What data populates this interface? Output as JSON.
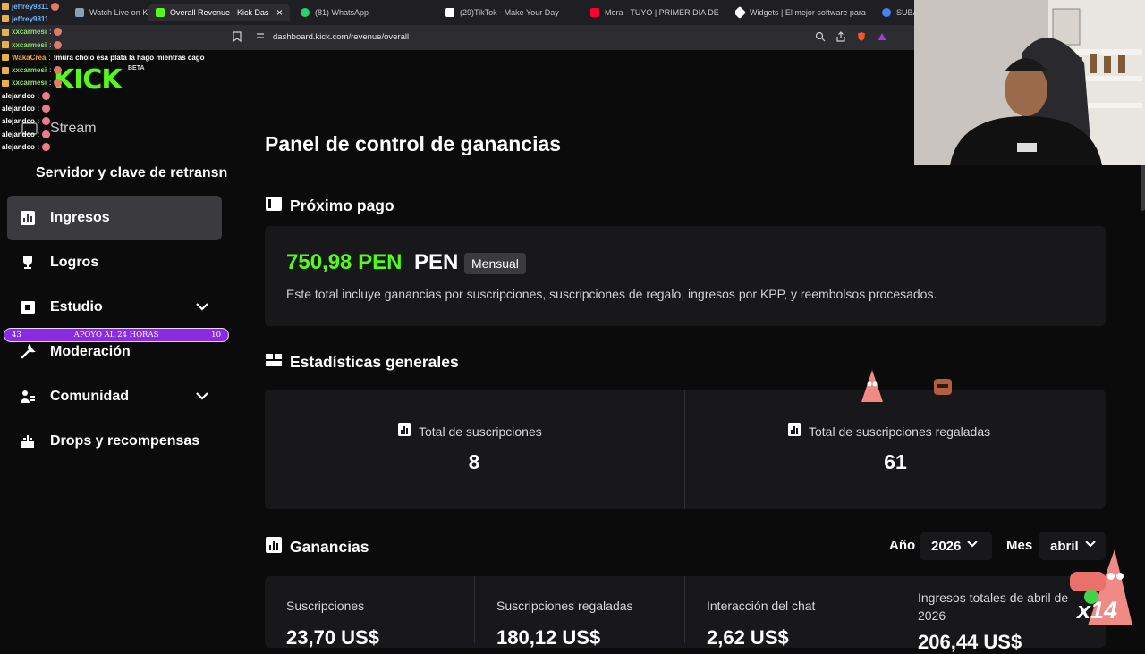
{
  "browser": {
    "tabs": [
      {
        "label": "Watch Live on K",
        "color": "#8aa0b8"
      },
      {
        "label": "Overall Revenue - Kick Dashboa",
        "color": "#53fc18",
        "active": true
      },
      {
        "label": "(81) WhatsApp",
        "color": "#25d366"
      },
      {
        "label": "(29)TikTok - Make Your Day",
        "color": "#ffffff"
      },
      {
        "label": "Mora - TUYO | PRIMER DIA DE CLAS",
        "color": "#ff0033"
      },
      {
        "label": "Widgets | El mejor software para po",
        "color": "#ffffff"
      },
      {
        "label": "SUBA",
        "color": "#4285f4"
      }
    ],
    "close_glyph": "×",
    "url": "dashboard.kick.com/revenue/overall"
  },
  "chat": [
    {
      "user": "jeffrey9811",
      "msg": "",
      "color": "blue"
    },
    {
      "user": "jeffrey9811",
      "msg": "",
      "color": "blue"
    },
    {
      "user": "xxcarmesi",
      "msg": "",
      "color": "green"
    },
    {
      "user": "xxcarmesi",
      "msg": "",
      "color": "green"
    },
    {
      "user": "WakaCrea",
      "msg": "!mura cholo esa plata la hago mientras cago",
      "color": "orange"
    },
    {
      "user": "xxcarmesi",
      "msg": "",
      "color": "green"
    },
    {
      "user": "xxcarmesi",
      "msg": "",
      "color": "green"
    },
    {
      "user": "alejandco",
      "msg": "",
      "color": "white"
    },
    {
      "user": "alejandco",
      "msg": "",
      "color": "white"
    },
    {
      "user": "alejandco",
      "msg": "",
      "color": "white"
    },
    {
      "user": "alejandco",
      "msg": "",
      "color": "white"
    },
    {
      "user": "alejandco",
      "msg": "",
      "color": "white"
    }
  ],
  "sidebar": {
    "logo": "KICK",
    "beta": "BETA",
    "stream": "Stream",
    "server_key": "Servidor y clave de retransn",
    "items": [
      {
        "label": "Ingresos",
        "icon": "bar-chart-icon",
        "active": true
      },
      {
        "label": "Logros",
        "icon": "trophy-icon"
      },
      {
        "label": "Estudio",
        "icon": "studio-icon",
        "expandable": true
      },
      {
        "label": "Moderación",
        "icon": "wrench-icon"
      },
      {
        "label": "Comunidad",
        "icon": "community-icon",
        "expandable": true
      },
      {
        "label": "Drops y recompensas",
        "icon": "gift-icon"
      }
    ]
  },
  "support_bar": {
    "left": "43",
    "label": "APOYO AL 24 HORAS",
    "right": "10"
  },
  "main": {
    "title": "Panel de control de ganancias",
    "next_payment": {
      "heading": "Próximo pago",
      "amount": "750,98 PEN",
      "currency": "PEN",
      "frequency": "Mensual",
      "description": "Este total incluye ganancias por suscripciones, suscripciones de regalo, ingresos por KPP, y reembolsos procesados."
    },
    "general_stats": {
      "heading": "Estadísticas generales",
      "total_subs_label": "Total de suscripciones",
      "total_subs_value": "8",
      "gifted_subs_label": "Total de suscripciones regaladas",
      "gifted_subs_value": "61"
    },
    "earnings": {
      "heading": "Ganancias",
      "year_label": "Año",
      "year_value": "2026",
      "month_label": "Mes",
      "month_value": "abril",
      "cards": [
        {
          "label": "Suscripciones",
          "value": "23,70 US$"
        },
        {
          "label": "Suscripciones regaladas",
          "value": "180,12 US$"
        },
        {
          "label": "Interacción del chat",
          "value": "2,62 US$"
        },
        {
          "label": "Ingresos totales de abril de 2026",
          "value": "206,44 US$"
        }
      ]
    }
  },
  "overlay": {
    "multiplier": "x14"
  }
}
